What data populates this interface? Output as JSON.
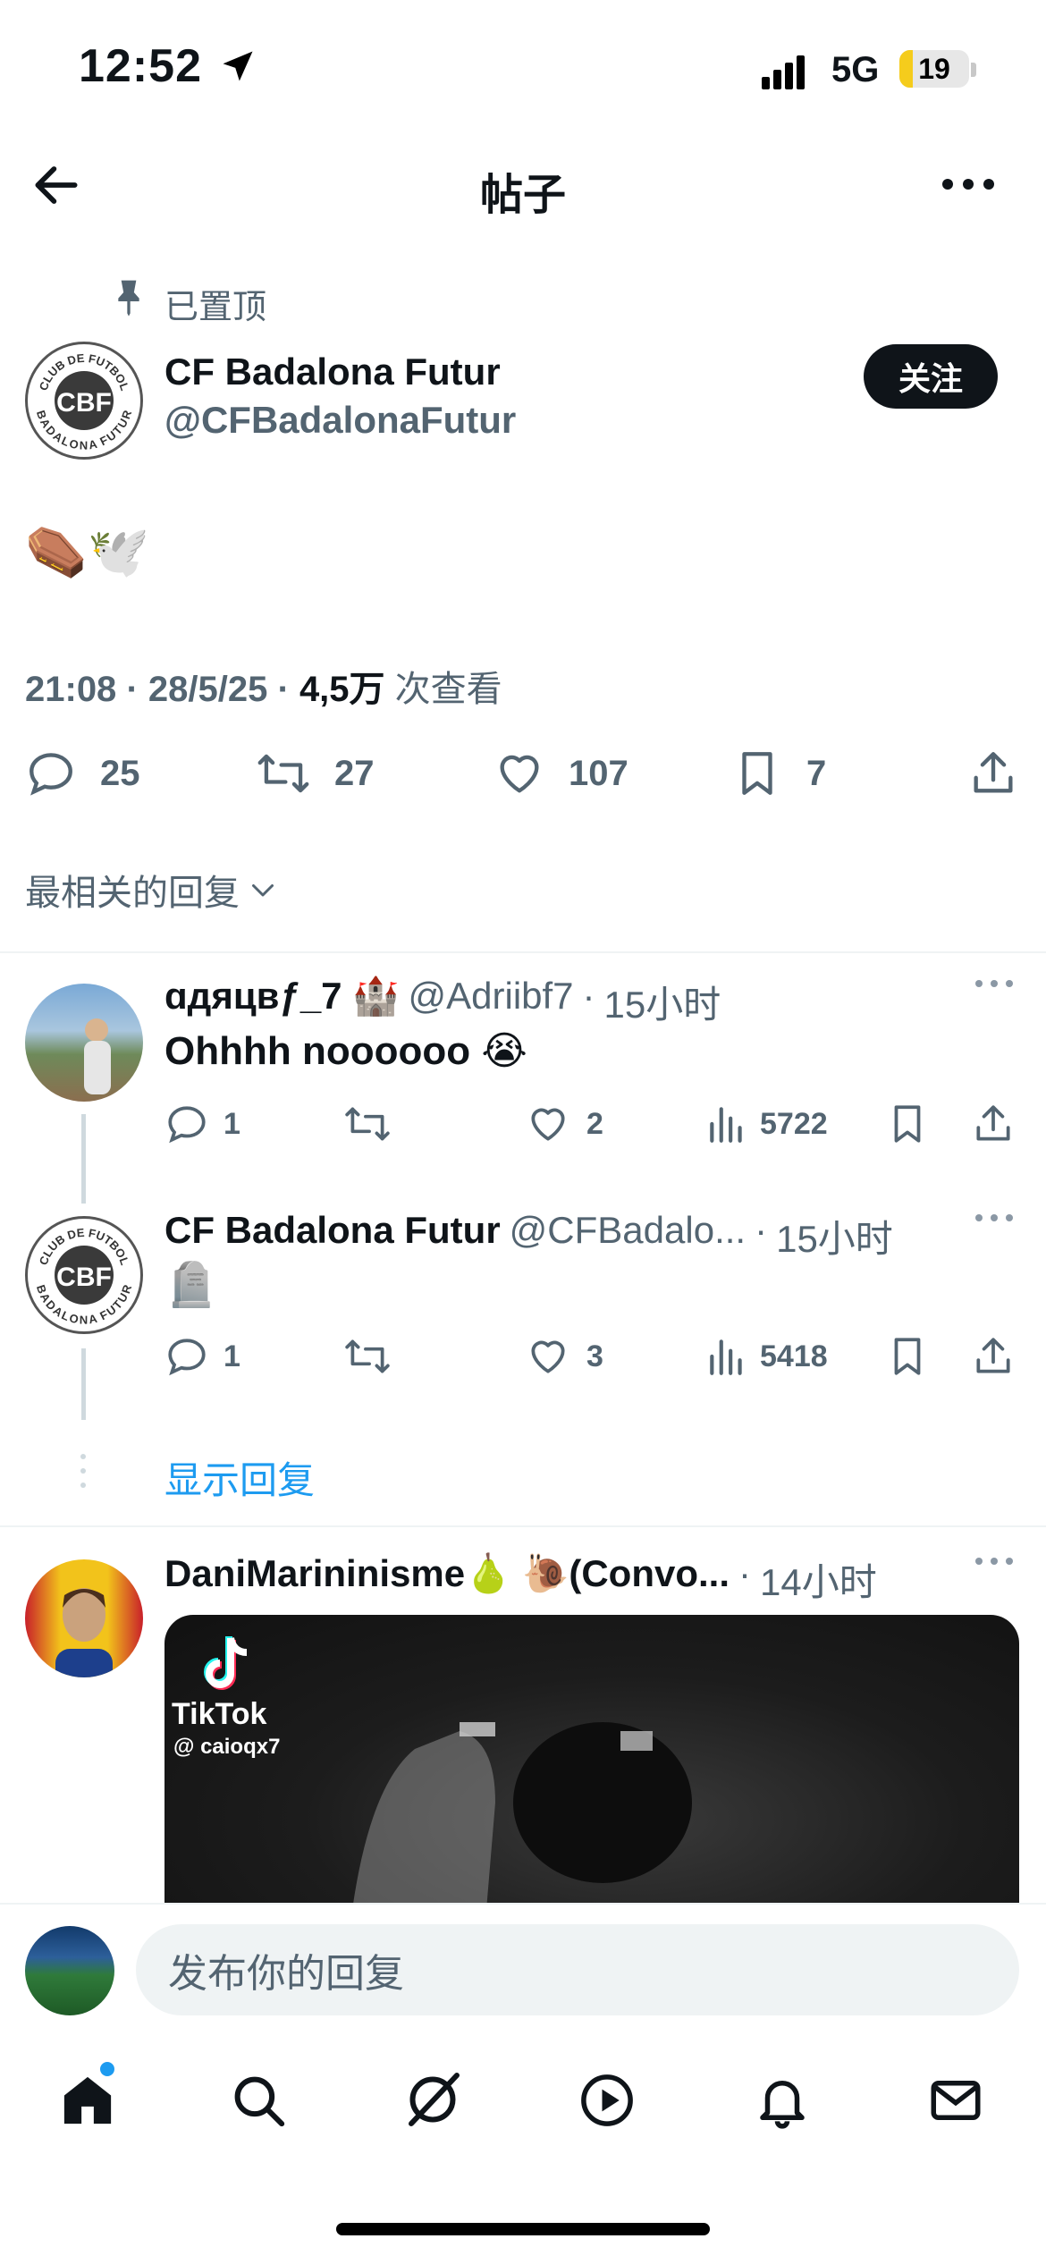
{
  "status_bar": {
    "time": "12:52",
    "network": "5G",
    "battery": "19",
    "battery_level_percent": 19
  },
  "header": {
    "title": "帖子"
  },
  "pinned_label": "已置顶",
  "tweet": {
    "author_name": "CF Badalona Futur",
    "author_handle": "@CFBadalonaFutur",
    "follow_label": "关注",
    "content_emoji": "⚰️🕊️",
    "time": "21:08",
    "date": "28/5/25",
    "views": "4,5万",
    "views_label": "次查看",
    "sep": "·",
    "stats": {
      "replies": "25",
      "retweets": "27",
      "likes": "107",
      "bookmarks": "7"
    }
  },
  "sort_label": "最相关的回复",
  "replies": [
    {
      "name": "ɑдяцвƒ_7 🏰",
      "handle": "@Adriibf7",
      "time": "15小时",
      "text": "Ohhhh noooooo 😭",
      "replies": "1",
      "likes": "2",
      "views": "5722"
    },
    {
      "name": "CF Badalona Futur",
      "handle": "@CFBadalo...",
      "time": "15小时",
      "text": "🪦",
      "replies": "1",
      "likes": "3",
      "views": "5418"
    },
    {
      "name": "DaniMarininisme🍐 🐌(Convo...",
      "time": "14小时"
    }
  ],
  "show_replies": "显示回复",
  "video": {
    "brand": "TikTok",
    "handle": "@ caioqx7"
  },
  "reply_placeholder": "发布你的回复",
  "logo_text": {
    "top": "CLUB DE FUTBOL",
    "bottom": "BADALONA FUTUR",
    "mono": "CBF"
  },
  "colors": {
    "accent": "#1d9bf0",
    "text": "#0f1419",
    "secondary": "#536471"
  }
}
